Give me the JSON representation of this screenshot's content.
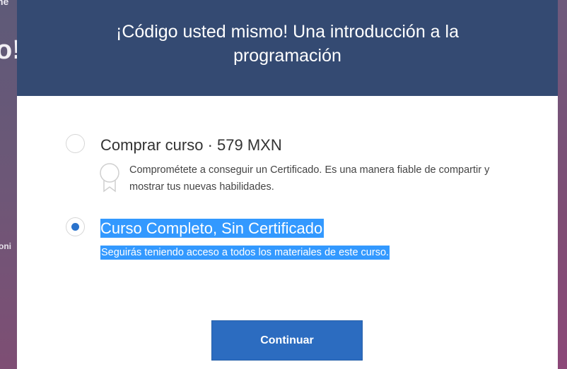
{
  "background": {
    "fragment_top": "ne",
    "fragment_mid": "o!",
    "fragment_low": "oni"
  },
  "modal": {
    "title": "¡Código usted mismo! Una introducción a la programación",
    "options": [
      {
        "title": "Comprar curso · 579 MXN",
        "description": "Comprométete a conseguir un Certificado. Es una manera fiable de compartir y mostrar tus nuevas habilidades.",
        "selected": false
      },
      {
        "title": "Curso Completo, Sin Certificado",
        "description": "Seguirás teniendo acceso a todos los materiales de este curso.",
        "selected": true
      }
    ],
    "continue_label": "Continuar"
  },
  "icons": {
    "close": "close-icon",
    "certificate": "ribbon-icon"
  },
  "colors": {
    "header_bg": "#344a72",
    "accent": "#2c6cc0",
    "selection": "#3399ff"
  }
}
